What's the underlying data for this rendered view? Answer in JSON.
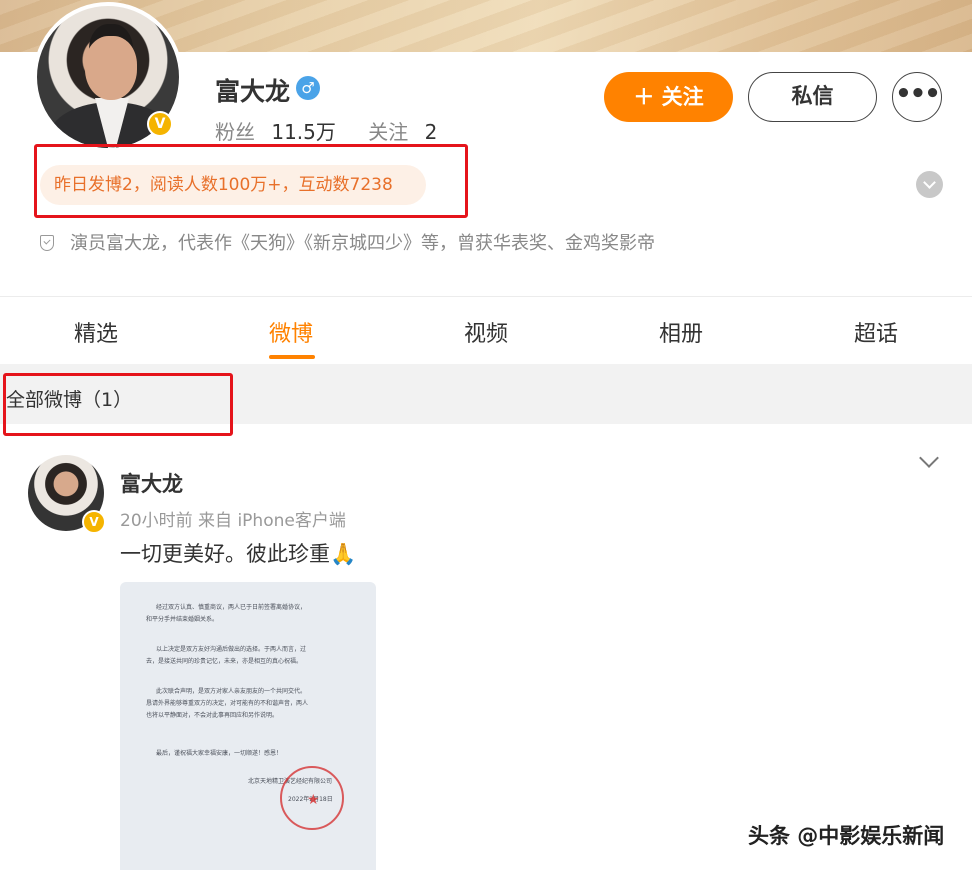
{
  "profile": {
    "name": "富大龙",
    "gender_symbol": "♂",
    "verified_mark": "V",
    "stats": {
      "fans_label": "粉丝",
      "fans_value": "11.5万",
      "follow_label": "关注",
      "follow_value": "2"
    },
    "follow_button": "＋ 关注",
    "message_button": "私信",
    "more_button": "•••",
    "activity_summary": "昨日发博2，阅读人数100万+，互动数7238",
    "bio": "演员富大龙，代表作《天狗》《新京城四少》等，曾获华表奖、金鸡奖影帝"
  },
  "tabs": [
    {
      "label": "精选"
    },
    {
      "label": "微博"
    },
    {
      "label": "视频"
    },
    {
      "label": "相册"
    },
    {
      "label": "超话"
    }
  ],
  "active_tab": "微博",
  "filter": {
    "label": "全部微博（1）"
  },
  "post": {
    "author": "富大龙",
    "meta": "20小时前 来自 iPhone客户端",
    "text": "一切更美好。彼此珍重🙏",
    "image": {
      "paragraphs": [
        "经过双方认真、慎重商议，两人已于日前签署离婚协议，",
        "和平分手并结束婚姻关系。",
        "以上决定是双方友好沟通后做出的选择。于两人而言，过",
        "去，是接送共同的珍贵记忆，未来，亦是相互的真心祝福。",
        "此次联合声明，是双方对家人亲友朋友的一个共同交代。",
        "恳请外界能够尊重双方的决定，对可能有的不和谐声音，两人",
        "也将以平静面对，不会对此事再回应和另作说明。",
        "最后，谨祝福大家幸福安康，一切顺遂！感恩！",
        "北京天地精卫演艺经纪有限公司",
        "2022年2月18日"
      ]
    }
  },
  "watermark": "头条 @中影娱乐新闻",
  "colors": {
    "accent": "#ff8200",
    "highlight_box": "#e5141b",
    "pill_bg": "#fdf0e6",
    "pill_text": "#e8702a",
    "verified": "#f5b400",
    "gender": "#4aa3e8"
  },
  "icons": [
    "gender-male-icon",
    "verified-badge-icon",
    "expand-icon",
    "shield-icon",
    "chevron-down-icon",
    "pray-emoji-icon"
  ]
}
